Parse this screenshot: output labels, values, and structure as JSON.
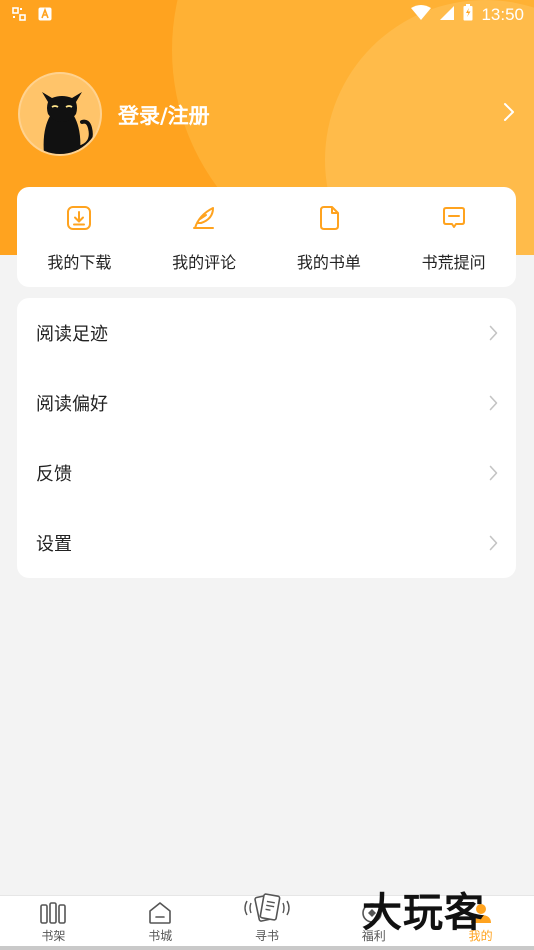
{
  "status_bar": {
    "time": "13:50"
  },
  "profile": {
    "login_label": "登录/注册"
  },
  "quick_actions": [
    {
      "label": "我的下载",
      "icon": "download-icon"
    },
    {
      "label": "我的评论",
      "icon": "feather-pen-icon"
    },
    {
      "label": "我的书单",
      "icon": "book-list-icon"
    },
    {
      "label": "书荒提问",
      "icon": "chat-bubble-icon"
    }
  ],
  "menu": [
    {
      "label": "阅读足迹"
    },
    {
      "label": "阅读偏好"
    },
    {
      "label": "反馈"
    },
    {
      "label": "设置"
    }
  ],
  "tabs": [
    {
      "label": "书架",
      "icon": "bookshelf-icon"
    },
    {
      "label": "书城",
      "icon": "store-icon"
    },
    {
      "label": "寻书",
      "icon": "find-book-icon"
    },
    {
      "label": "福利",
      "icon": "gift-icon"
    },
    {
      "label": "我的",
      "icon": "profile-icon",
      "active": true
    }
  ],
  "watermark": "大玩客",
  "colors": {
    "accent": "#ffa31f",
    "background": "#f3f3f3"
  }
}
